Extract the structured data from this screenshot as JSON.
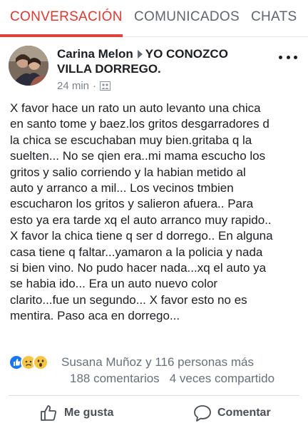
{
  "tabs": [
    {
      "label": "CONVERSACIÓN",
      "active": true
    },
    {
      "label": "COMUNICADOS",
      "active": false
    },
    {
      "label": "CHATS",
      "active": false
    }
  ],
  "post": {
    "author": "Carina Melon",
    "group": "YO CONOZCO VILLA DORREGO.",
    "time": "24 min",
    "body_lines": [
      "X favor hace un rato un auto levanto una chica",
      "en santo tome y baez.los gritos desgarradores d",
      "la chica se escuchaban muy bien.gritaba q la",
      "suelten... No se qien era..mi mama escucho los",
      "gritos y salio corriendo y la habian metido al",
      "auto y arranco a mil... Los vecinos tmbien",
      "escucharon los gritos y salieron afuera.. Para",
      "esto ya era tarde xq el auto arranco muy rapido..",
      "X favor la chica tiene q ser d dorrego.. En alguna",
      "casa tiene q faltar...yamaron a la policia y nada",
      "si bien vino. No pudo hacer nada...xq el auto ya",
      "se habia ido... Era un auto nuevo color",
      "clarito...fue un segundo... X favor esto no es",
      "mentira. Paso aca en dorrego..."
    ],
    "reactions_text": "Susana Muñoz y 116 personas más",
    "comments_count": "188 comentarios",
    "shares_count": "4 veces compartido"
  },
  "actions": {
    "like_label": "Me gusta",
    "comment_label": "Comentar"
  },
  "icons": {
    "reactions": [
      "like-icon",
      "sad-icon",
      "wow-icon"
    ],
    "like_color": "#1877f2",
    "emoji_color": "#f7c544",
    "accent": "#e0433b"
  }
}
